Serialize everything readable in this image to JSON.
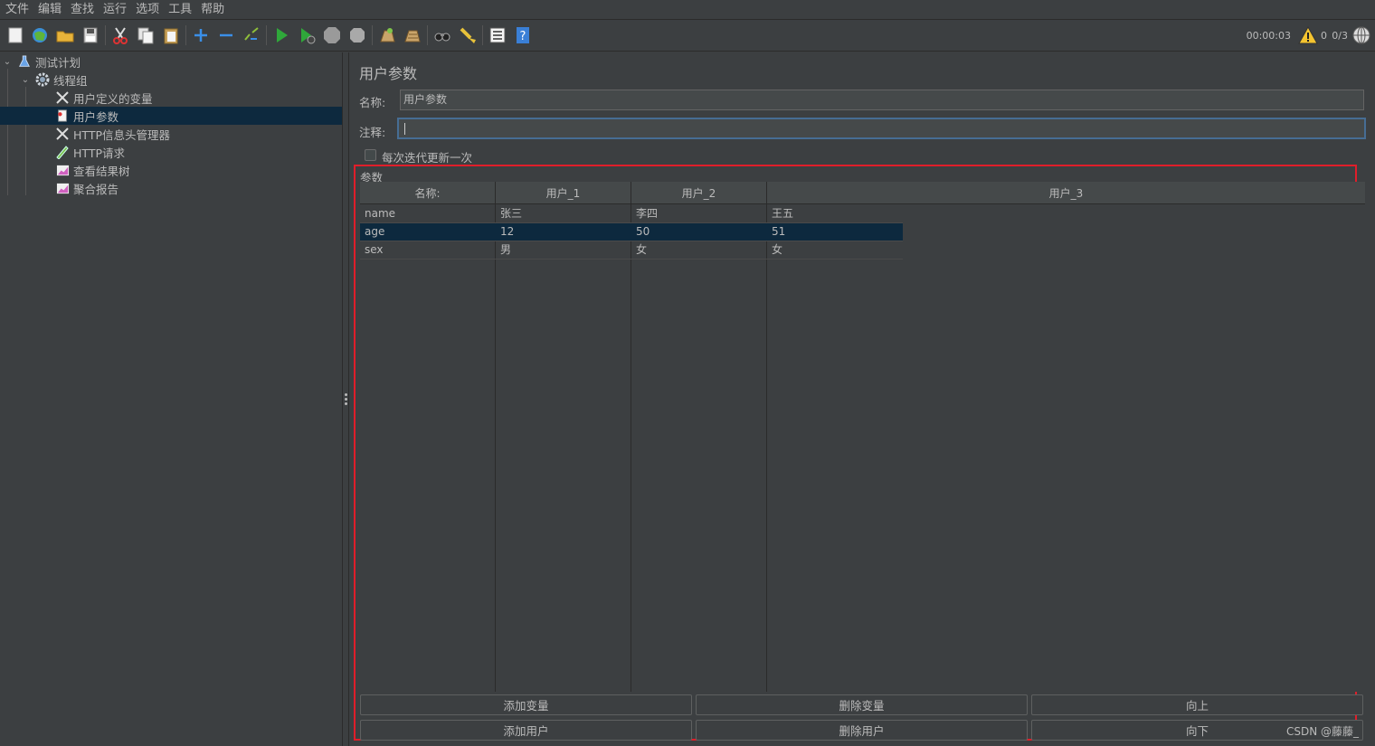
{
  "menu": [
    "文件",
    "编辑",
    "查找",
    "运行",
    "选项",
    "工具",
    "帮助"
  ],
  "toolbar": {
    "timer": "00:00:03",
    "error_count": "0",
    "thread_count": "0/3",
    "icons": [
      "new-icon",
      "templates-icon",
      "open-icon",
      "save-icon",
      "cut-icon",
      "copy-icon",
      "paste-icon",
      "expand-icon",
      "collapse-icon",
      "toggle-icon",
      "start-icon",
      "start-no-pause-icon",
      "stop-icon",
      "shutdown-icon",
      "clear-icon",
      "clear-all-icon",
      "search-icon",
      "reset-search-icon",
      "function-helper-icon",
      "help-icon"
    ]
  },
  "tree": {
    "items": [
      {
        "label": "测试计划",
        "icon": "flask-icon",
        "level": 0
      },
      {
        "label": "线程组",
        "icon": "gear-icon",
        "level": 1
      },
      {
        "label": "用户定义的变量",
        "icon": "wrench-icon",
        "level": 2
      },
      {
        "label": "用户参数",
        "icon": "preprocessor-icon",
        "level": 2,
        "selected": true
      },
      {
        "label": "HTTP信息头管理器",
        "icon": "wrench-icon",
        "level": 2
      },
      {
        "label": "HTTP请求",
        "icon": "pen-icon",
        "level": 2
      },
      {
        "label": "查看结果树",
        "icon": "graph-icon",
        "level": 2
      },
      {
        "label": "聚合报告",
        "icon": "graph-icon",
        "level": 2
      }
    ]
  },
  "panel": {
    "title": "用户参数",
    "name_label": "名称:",
    "name_value": "用户参数",
    "comment_label": "注释:",
    "comment_value": "",
    "checkbox_label": "每次迭代更新一次",
    "params_label": "参数"
  },
  "table": {
    "headers": [
      "名称:",
      "用户_1",
      "用户_2",
      "用户_3"
    ],
    "rows": [
      [
        "name",
        "张三",
        "李四",
        "王五"
      ],
      [
        "age",
        "12",
        "50",
        "51"
      ],
      [
        "sex",
        "男",
        "女",
        "女"
      ]
    ],
    "selected_row": 1
  },
  "buttons": {
    "add_variable": "添加变量",
    "delete_variable": "删除变量",
    "up": "向上",
    "add_user": "添加用户",
    "delete_user": "删除用户",
    "down": "向下"
  },
  "watermark": "CSDN @藤藤_",
  "colors": {
    "background": "#3c3f41",
    "selection": "#0d293e",
    "highlight_border": "#e01e2a",
    "focus_border": "#466d94"
  }
}
